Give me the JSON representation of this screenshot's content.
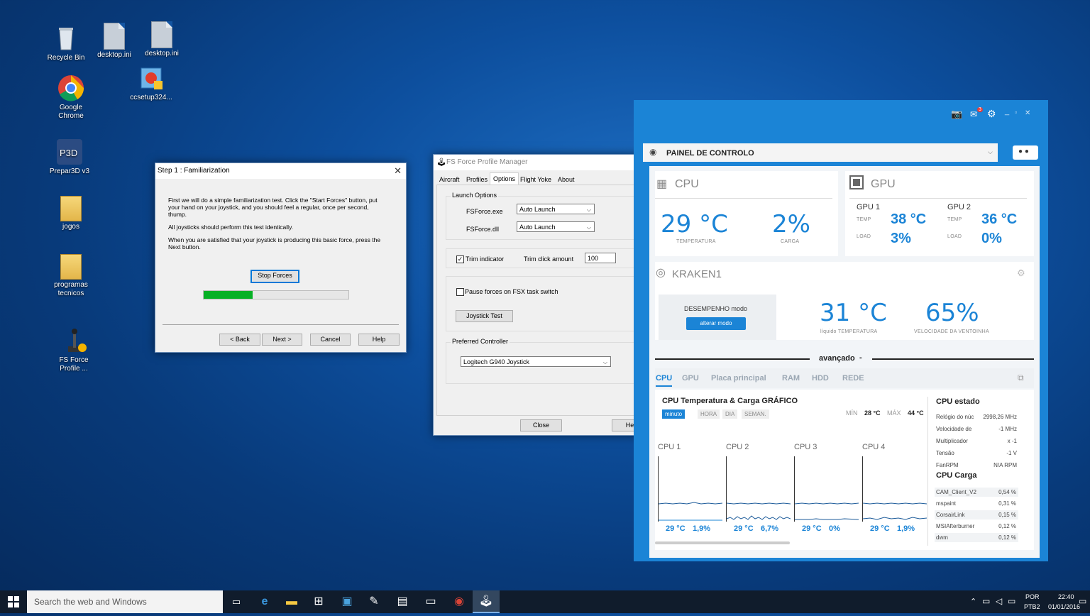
{
  "desktop": {
    "icons": [
      {
        "label": "Recycle Bin"
      },
      {
        "label": "desktop.ini"
      },
      {
        "label": "desktop.ini"
      },
      {
        "label": "ccsetup324..."
      },
      {
        "label": "Google Chrome"
      },
      {
        "label": "Prepar3D v3"
      },
      {
        "label": "jogos"
      },
      {
        "label": "programas tecnicos"
      },
      {
        "label": "FS Force Profile ..."
      }
    ]
  },
  "step_dialog": {
    "title": "Step 1 : Familiarization",
    "para1": "First we will do a simple familiarization test.  Click the \"Start Forces\" button, put your hand on your joystick, and you should feel a regular, once per second, thump.",
    "para2": "All joysticks should perform this test identically.",
    "para3": "When you are satisfied that your joystick is producing this basic force, press the Next button.",
    "stop_forces": "Stop Forces",
    "progress": 0.34,
    "back": "< Back",
    "next": "Next >",
    "cancel": "Cancel",
    "help": "Help"
  },
  "profile_manager": {
    "title": "FS Force Profile Manager",
    "tabs": [
      "Aircraft",
      "Profiles",
      "Options",
      "Flight Yoke",
      "About"
    ],
    "active_tab": "Options",
    "launch_options": "Launch Options",
    "fsforce_exe_label": "FSForce.exe",
    "fsforce_exe_value": "Auto Launch",
    "fsforce_dll_label": "FSForce.dll",
    "fsforce_dll_value": "Auto Launch",
    "trim_indicator": "Trim indicator",
    "trim_click_amount": "Trim click amount",
    "trim_value": "100",
    "pause_forces": "Pause forces on FSX task switch",
    "joystick_test": "Joystick Test",
    "preferred_controller": "Preferred Controller",
    "controller_value": "Logitech G940 Joystick",
    "close": "Close",
    "help": "Help"
  },
  "cam": {
    "notif_count": "3",
    "dashboard": "PAINEL DE CONTROLO",
    "cpu": {
      "title": "CPU",
      "temp": "29 °C",
      "temp_label": "TEMPERATURA",
      "load": "2%",
      "load_label": "CARGA"
    },
    "gpu": {
      "title": "GPU",
      "gpu1": {
        "name": "GPU 1",
        "temp": "38 °C",
        "load": "3%"
      },
      "gpu2": {
        "name": "GPU 2",
        "temp": "36 °C",
        "load": "0%"
      },
      "temp_label": "TEMP",
      "load_label": "LOAD"
    },
    "kraken": {
      "title": "KRAKEN1",
      "mode": "DESEMPENHO modo",
      "change_mode": "alterar modo",
      "liquid_temp": "31 °C",
      "liquid_label": "líquido TEMPERATURA",
      "fan": "65%",
      "fan_label": "VELOCIDADE DA VENTOINHA"
    },
    "advanced": "avançado",
    "tabs": [
      "CPU",
      "GPU",
      "Placa principal",
      "RAM",
      "HDD",
      "REDE"
    ],
    "chart": {
      "title": "CPU Temperatura & Carga GRÁFICO",
      "ranges": [
        "minuto",
        "HORA",
        "DIA",
        "SEMAN."
      ],
      "min_label": "MÍN",
      "min_val": "28 °C",
      "max_label": "MÁX",
      "max_val": "44 °C"
    },
    "cores": [
      {
        "name": "CPU 1",
        "temp": "29 °C",
        "load": "1,9%"
      },
      {
        "name": "CPU 2",
        "temp": "29 °C",
        "load": "6,7%"
      },
      {
        "name": "CPU 3",
        "temp": "29 °C",
        "load": "0%"
      },
      {
        "name": "CPU 4",
        "temp": "29 °C",
        "load": "1,9%"
      }
    ],
    "status_title": "CPU estado",
    "status": [
      {
        "k": "Relógio do núc",
        "v": "2998,26 MHz"
      },
      {
        "k": "Velocidade de",
        "v": "-1 MHz"
      },
      {
        "k": "Multiplicador",
        "v": "x -1"
      },
      {
        "k": "Tensão",
        "v": "-1 V"
      },
      {
        "k": "FanRPM",
        "v": "N/A RPM"
      }
    ],
    "load_title": "CPU Carga",
    "loads": [
      {
        "k": "CAM_Client_V2",
        "v": "0,54 %"
      },
      {
        "k": "mspaint",
        "v": "0,31 %"
      },
      {
        "k": "CorsairLink",
        "v": "0,15 %"
      },
      {
        "k": "MSIAfterburner",
        "v": "0,12 %"
      },
      {
        "k": "dwm",
        "v": "0,12 %"
      }
    ]
  },
  "taskbar": {
    "search": "Search the web and Windows",
    "lang1": "POR",
    "lang2": "PTB2",
    "time": "22:40",
    "date": "01/01/2016"
  }
}
